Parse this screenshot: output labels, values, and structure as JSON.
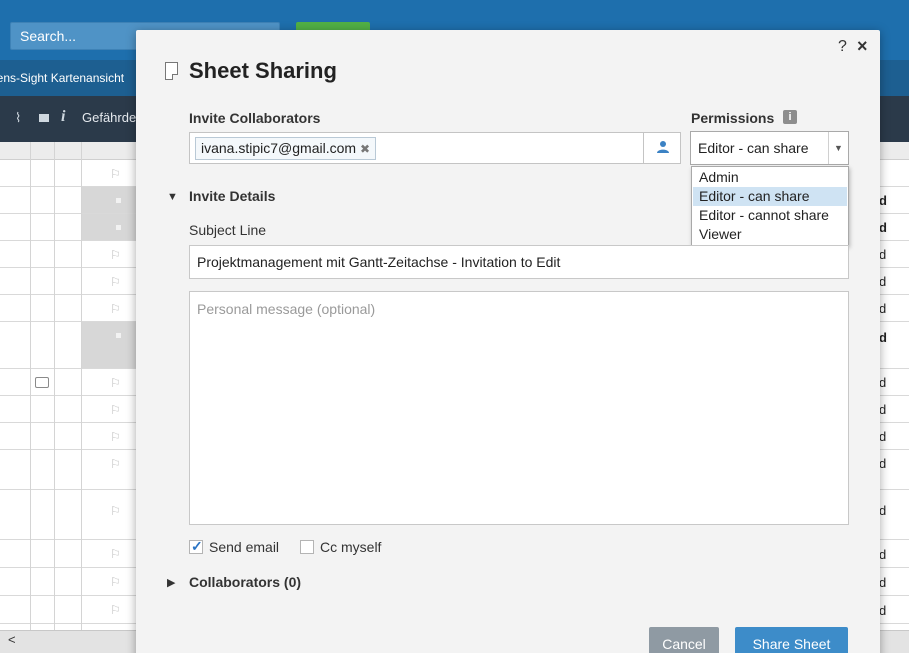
{
  "app": {
    "search_placeholder": "Search...",
    "tab_label": "Lens-Sight Kartenansicht",
    "column_label": "Gefährdet",
    "column_icons": [
      "paperclip-icon",
      "comment-icon",
      "info-icon"
    ],
    "right_column_values": [
      "d",
      "d",
      "d",
      "d",
      "d",
      "d",
      "d",
      "d",
      "d",
      "d",
      "d",
      "d",
      "d",
      "d"
    ]
  },
  "modal": {
    "title": "Sheet Sharing",
    "help_label": "?",
    "close_label": "×",
    "invite": {
      "label": "Invite Collaborators",
      "chips": [
        "ivana.stipic7@gmail.com"
      ]
    },
    "permissions": {
      "label": "Permissions",
      "info_label": "i",
      "selected": "Editor - can share",
      "options": [
        "Admin",
        "Editor - can share",
        "Editor - cannot share",
        "Viewer"
      ]
    },
    "details": {
      "label": "Invite Details",
      "subject_label": "Subject Line",
      "subject_value": "Projektmanagement mit Gantt-Zeitachse - Invitation to Edit",
      "message_placeholder": "Personal message (optional)"
    },
    "send_email": {
      "label": "Send email",
      "checked": true
    },
    "cc_myself": {
      "label": "Cc myself",
      "checked": false
    },
    "collaborators_label": "Collaborators (0)",
    "cancel_label": "Cancel",
    "share_label": "Share Sheet"
  },
  "colors": {
    "topbar": "#1e6fad",
    "tabbar": "#1d5f91",
    "grid_header": "#2b3a4a",
    "share_button": "#3d8cc9",
    "cancel_button": "#8f9aa3",
    "selected_option": "#cfe3f3"
  }
}
